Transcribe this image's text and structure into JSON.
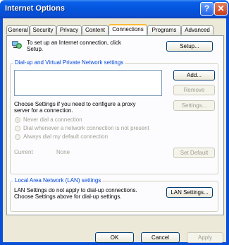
{
  "window": {
    "title": "Internet Options",
    "help_glyph": "?",
    "close_glyph": "✕"
  },
  "tabs": [
    "General",
    "Security",
    "Privacy",
    "Content",
    "Connections",
    "Programs",
    "Advanced"
  ],
  "active_tab": "Connections",
  "setup": {
    "text_line1": "To set up an Internet connection, click",
    "text_line2": "Setup.",
    "button": "Setup..."
  },
  "dialup": {
    "group_label": "Dial-up and Virtual Private Network settings",
    "add": "Add...",
    "remove": "Remove",
    "proxy_line1": "Choose Settings if you need to configure a proxy",
    "proxy_line2": "server for a connection.",
    "settings": "Settings...",
    "radio_never": "Never dial a connection",
    "radio_whenever": "Dial whenever a network connection is not present",
    "radio_always": "Always dial my default connection",
    "current_label": "Current",
    "current_value": "None",
    "set_default": "Set Default"
  },
  "lan": {
    "group_label": "Local Area Network (LAN) settings",
    "text_line1": "LAN Settings do not apply to dial-up connections.",
    "text_line2": "Choose Settings above for dial-up settings.",
    "button": "LAN Settings..."
  },
  "footer": {
    "ok": "OK",
    "cancel": "Cancel",
    "apply": "Apply"
  }
}
